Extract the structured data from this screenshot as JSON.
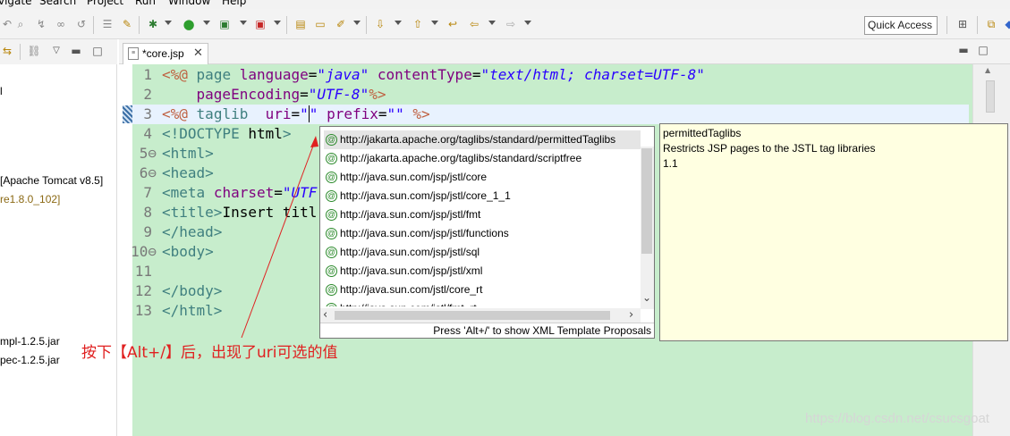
{
  "menu": {
    "items": [
      "vigate",
      "Search",
      "Project",
      "Run",
      "Window",
      "Help"
    ]
  },
  "toolbar": {
    "quick_access": "Quick Access"
  },
  "left_panel": {
    "items": [
      {
        "text": "l",
        "color": "#000000"
      },
      {
        "text": "[Apache Tomcat v8.5]",
        "color": "#000000"
      },
      {
        "text": "re1.8.0_102]",
        "color": "#8b6914"
      },
      {
        "text": "mpl-1.2.5.jar",
        "color": "#000000"
      },
      {
        "text": "pec-1.2.5.jar",
        "color": "#000000"
      }
    ]
  },
  "editor": {
    "tab_label": "*core.jsp",
    "line_numbers": [
      "1",
      "2",
      "3",
      "4",
      "5⊖",
      "6⊖",
      "7",
      "8",
      "9",
      "10⊖",
      "11",
      "12",
      "13"
    ]
  },
  "autocomplete": {
    "items": [
      "http://jakarta.apache.org/taglibs/standard/permittedTaglibs",
      "http://jakarta.apache.org/taglibs/standard/scriptfree",
      "http://java.sun.com/jsp/jstl/core",
      "http://java.sun.com/jsp/jstl/core_1_1",
      "http://java.sun.com/jsp/jstl/fmt",
      "http://java.sun.com/jsp/jstl/functions",
      "http://java.sun.com/jsp/jstl/sql",
      "http://java.sun.com/jsp/jstl/xml",
      "http://java.sun.com/jstl/core_rt",
      "http://java.sun.com/jstl/fmt_rt"
    ],
    "status": "Press 'Alt+/' to show XML Template Proposals",
    "item_icon": "@"
  },
  "info": {
    "name": "permittedTaglibs",
    "description": "Restricts JSP pages to the JSTL tag libraries",
    "version": "1.1"
  },
  "annotation": {
    "text": "按下【Alt+/】后，出现了uri可选的值",
    "color": "#e02020"
  },
  "watermark": "https://blog.csdn.net/csucsgoat"
}
